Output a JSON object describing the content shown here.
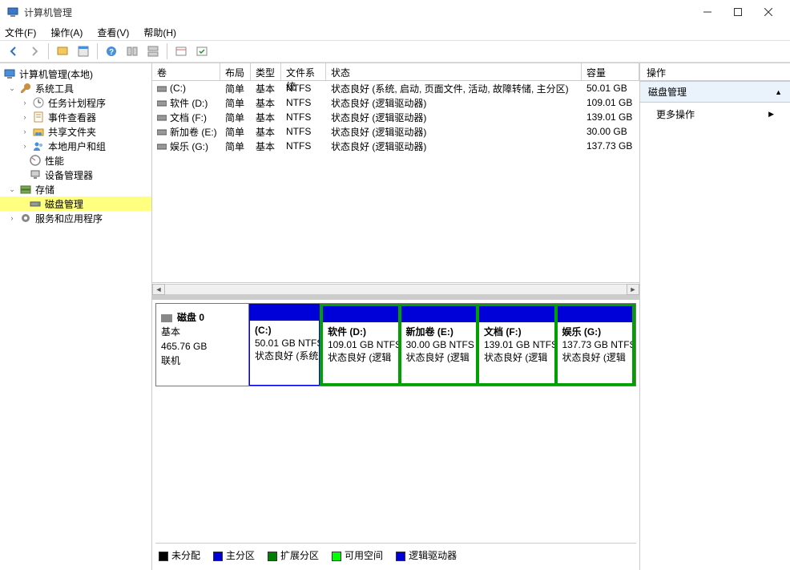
{
  "window": {
    "title": "计算机管理"
  },
  "menu": {
    "file": "文件(F)",
    "action": "操作(A)",
    "view": "查看(V)",
    "help": "帮助(H)"
  },
  "tree": {
    "root": "计算机管理(本地)",
    "systools": "系统工具",
    "taskscheduler": "任务计划程序",
    "eventviewer": "事件查看器",
    "sharedfolders": "共享文件夹",
    "localusers": "本地用户和组",
    "performance": "性能",
    "devicemgr": "设备管理器",
    "storage": "存储",
    "diskmgmt": "磁盘管理",
    "services": "服务和应用程序"
  },
  "grid": {
    "headers": {
      "volume": "卷",
      "layout": "布局",
      "type": "类型",
      "fs": "文件系统",
      "status": "状态",
      "capacity": "容量"
    },
    "rows": [
      {
        "vol": "(C:)",
        "lay": "简单",
        "typ": "基本",
        "fs": "NTFS",
        "st": "状态良好 (系统, 启动, 页面文件, 活动, 故障转储, 主分区)",
        "cap": "50.01 GB"
      },
      {
        "vol": "软件 (D:)",
        "lay": "简单",
        "typ": "基本",
        "fs": "NTFS",
        "st": "状态良好 (逻辑驱动器)",
        "cap": "109.01 GB"
      },
      {
        "vol": "文档 (F:)",
        "lay": "简单",
        "typ": "基本",
        "fs": "NTFS",
        "st": "状态良好 (逻辑驱动器)",
        "cap": "139.01 GB"
      },
      {
        "vol": "新加卷 (E:)",
        "lay": "简单",
        "typ": "基本",
        "fs": "NTFS",
        "st": "状态良好 (逻辑驱动器)",
        "cap": "30.00 GB"
      },
      {
        "vol": "娱乐 (G:)",
        "lay": "简单",
        "typ": "基本",
        "fs": "NTFS",
        "st": "状态良好 (逻辑驱动器)",
        "cap": "137.73 GB"
      }
    ]
  },
  "disk": {
    "name": "磁盘 0",
    "type": "基本",
    "size": "465.76 GB",
    "status": "联机",
    "partitions": [
      {
        "name": "(C:)",
        "size": "50.01 GB NTFS",
        "status": "状态良好 (系统",
        "kind": "primary"
      },
      {
        "name": "软件  (D:)",
        "size": "109.01 GB NTFS",
        "status": "状态良好 (逻辑",
        "kind": "logical"
      },
      {
        "name": "新加卷  (E:)",
        "size": "30.00 GB NTFS",
        "status": "状态良好 (逻辑",
        "kind": "logical"
      },
      {
        "name": "文档  (F:)",
        "size": "139.01 GB NTFS",
        "status": "状态良好 (逻辑",
        "kind": "logical"
      },
      {
        "name": "娱乐  (G:)",
        "size": "137.73 GB NTFS",
        "status": "状态良好 (逻辑",
        "kind": "logical"
      }
    ]
  },
  "legend": {
    "unallocated": "未分配",
    "primary": "主分区",
    "extended": "扩展分区",
    "free": "可用空间",
    "logical": "逻辑驱动器"
  },
  "actions": {
    "title": "操作",
    "section": "磁盘管理",
    "more": "更多操作"
  }
}
